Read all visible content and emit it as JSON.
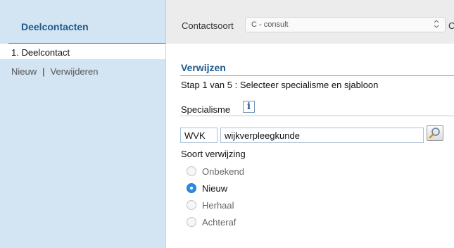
{
  "sidebar": {
    "title": "Deelcontacten",
    "active_tab": "1. Deelcontact",
    "new_link": "Nieuw",
    "separator": "|",
    "delete_link": "Verwijderen"
  },
  "header": {
    "contactsoort_label": "Contactsoort",
    "contactsoort_value": "C - consult",
    "trailing_text": "Con"
  },
  "form": {
    "title": "Verwijzen",
    "step_text": "Stap 1 van 5 : Selecteer specialisme en sjabloon",
    "specialisme_label": "Specialisme",
    "specialisme_code": "WVK",
    "specialisme_name": "wijkverpleegkunde",
    "soort_label": "Soort verwijzing",
    "options": [
      {
        "label": "Onbekend",
        "checked": false
      },
      {
        "label": "Nieuw",
        "checked": true
      },
      {
        "label": "Herhaal",
        "checked": false
      },
      {
        "label": "Achteraf",
        "checked": false
      }
    ]
  },
  "colors": {
    "accent": "#1d5a8e",
    "sidebar_bg": "#d3e4f2",
    "radio_checked": "#2c8ae8"
  },
  "icons": {
    "info": "info-icon",
    "search": "magnifier-icon",
    "select_arrows": "updown-chevron-icon"
  }
}
